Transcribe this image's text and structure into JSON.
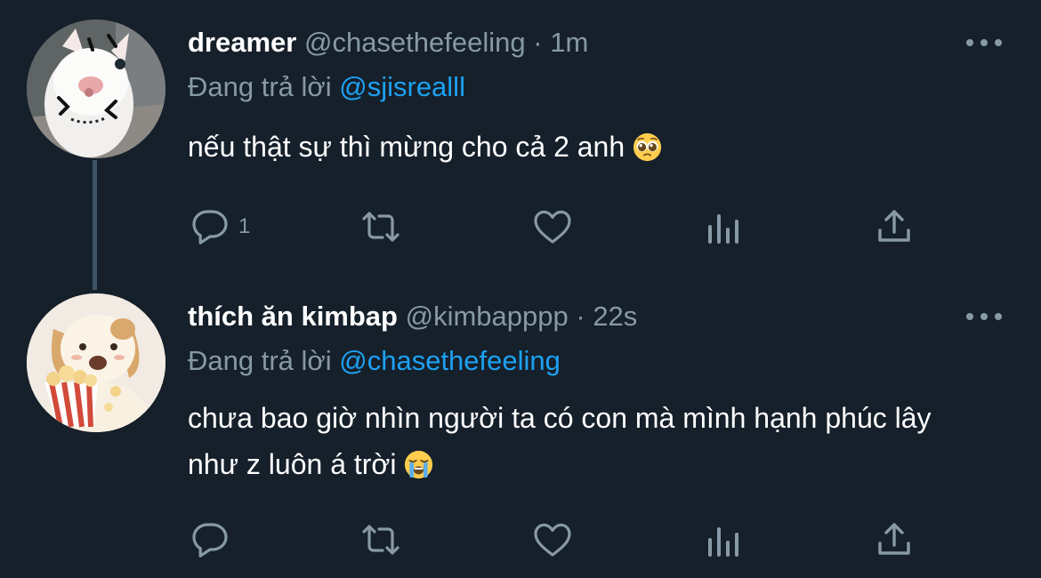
{
  "thread": [
    {
      "display_name": "dreamer",
      "handle": "@chasethefeeling",
      "separator": "·",
      "time": "1m",
      "reply_prefix": "Đang trả lời",
      "reply_to": "@sjisrealll",
      "text": "nếu thật sự thì mừng cho cả 2 anh",
      "emoji": "pleading-face",
      "reply_count": "1",
      "avatar": "cat-photo"
    },
    {
      "display_name": "thích ăn kimbap",
      "handle": "@kimbapppp",
      "separator": "·",
      "time": "22s",
      "reply_prefix": "Đang trả lời",
      "reply_to": "@chasethefeeling",
      "text": "chưa bao giờ nhìn người ta có con mà mình hạnh phúc lây như z luôn á trời",
      "emoji": "loudly-crying-face",
      "reply_count": "",
      "avatar": "puppy-popcorn-illustration"
    }
  ],
  "colors": {
    "background": "#15202b",
    "secondary_text": "#8899a6",
    "link": "#1da1f2",
    "thread_line": "#3d5466"
  },
  "icons": [
    "reply-icon",
    "retweet-icon",
    "like-icon",
    "analytics-icon",
    "share-icon",
    "more-icon"
  ]
}
